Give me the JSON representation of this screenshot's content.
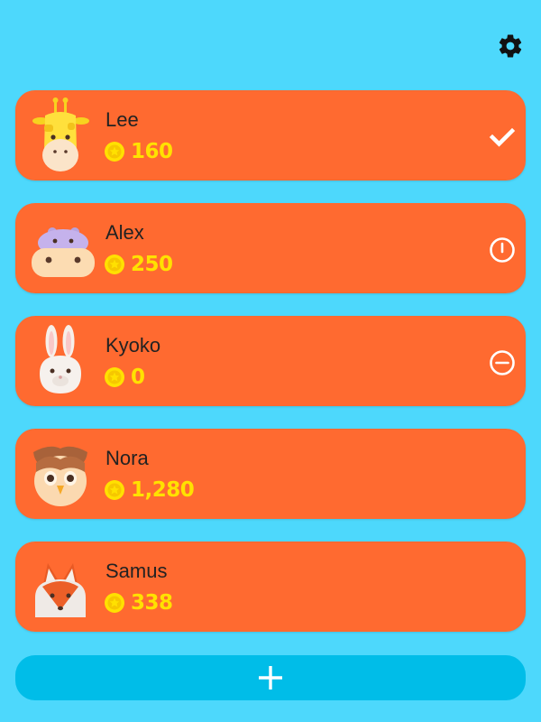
{
  "settings": {
    "icon": "gear-icon"
  },
  "players": [
    {
      "name": "Lee",
      "coins": "160",
      "avatar": "giraffe-icon",
      "status": "check-icon"
    },
    {
      "name": "Alex",
      "coins": "250",
      "avatar": "hippo-icon",
      "status": "power-icon"
    },
    {
      "name": "Kyoko",
      "coins": "0",
      "avatar": "rabbit-icon",
      "status": "remove-icon"
    },
    {
      "name": "Nora",
      "coins": "1,280",
      "avatar": "owl-icon",
      "status": ""
    },
    {
      "name": "Samus",
      "coins": "338",
      "avatar": "fox-icon",
      "status": ""
    }
  ],
  "add_button": {
    "icon": "plus-icon"
  },
  "colors": {
    "background": "#4dd8fc",
    "card": "#ff6a30",
    "coin_text": "#ffe100",
    "add_button": "#00bde8"
  }
}
